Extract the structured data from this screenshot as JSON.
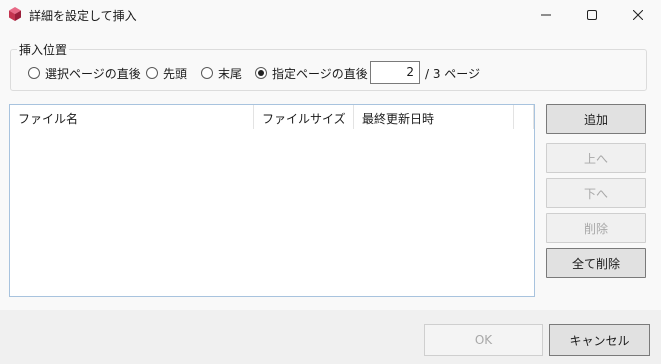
{
  "window": {
    "title": "詳細を設定して挿入",
    "controls": {
      "minimize": "minimize-icon",
      "maximize": "maximize-icon",
      "close": "close-icon"
    }
  },
  "insert_position": {
    "legend": "挿入位置",
    "options": [
      {
        "label": "選択ページの直後",
        "checked": false
      },
      {
        "label": "先頭",
        "checked": false
      },
      {
        "label": "末尾",
        "checked": false
      },
      {
        "label": "指定ページの直後",
        "checked": true
      }
    ],
    "page_value": "2",
    "page_suffix": "/ 3 ページ"
  },
  "file_list": {
    "columns": [
      "ファイル名",
      "ファイルサイズ",
      "最終更新日時"
    ],
    "rows": []
  },
  "side_buttons": [
    {
      "label": "追加",
      "enabled": true
    },
    {
      "label": "上へ",
      "enabled": false
    },
    {
      "label": "下へ",
      "enabled": false
    },
    {
      "label": "削除",
      "enabled": false
    },
    {
      "label": "全て削除",
      "enabled": true
    }
  ],
  "footer": {
    "ok_label": "OK",
    "ok_enabled": false,
    "cancel_label": "キャンセル"
  },
  "colors": {
    "app_icon": "#c4344f",
    "list_border": "#a8c3de"
  }
}
